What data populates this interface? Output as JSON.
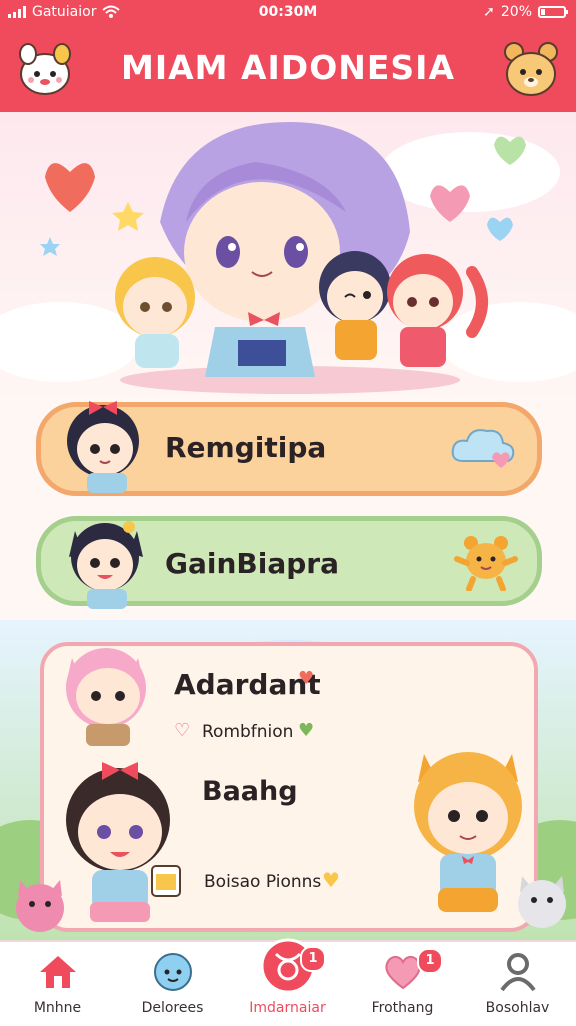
{
  "status_bar": {
    "carrier": "Gatuiaior",
    "time": "00:30M",
    "battery": "20%",
    "battery_level": 0.2
  },
  "header": {
    "title": "MIAM AIDONESIA"
  },
  "menu": [
    {
      "label": "Remgitipa"
    },
    {
      "label": "GainBiapra"
    }
  ],
  "panel": {
    "title": "Adardant",
    "subtitle": "Rombfnion",
    "section": "Baahg",
    "footer": "Boisao Pionns"
  },
  "tabs": [
    {
      "label": "Mnhne"
    },
    {
      "label": "Delorees"
    },
    {
      "label": "Imdarnaiar",
      "badge": "1"
    },
    {
      "label": "Frothang",
      "badge": "1"
    },
    {
      "label": "Bosohlav"
    }
  ],
  "colors": {
    "accent": "#ef4b5d",
    "card1": "#fbd29c",
    "card2": "#cfe8b8"
  }
}
